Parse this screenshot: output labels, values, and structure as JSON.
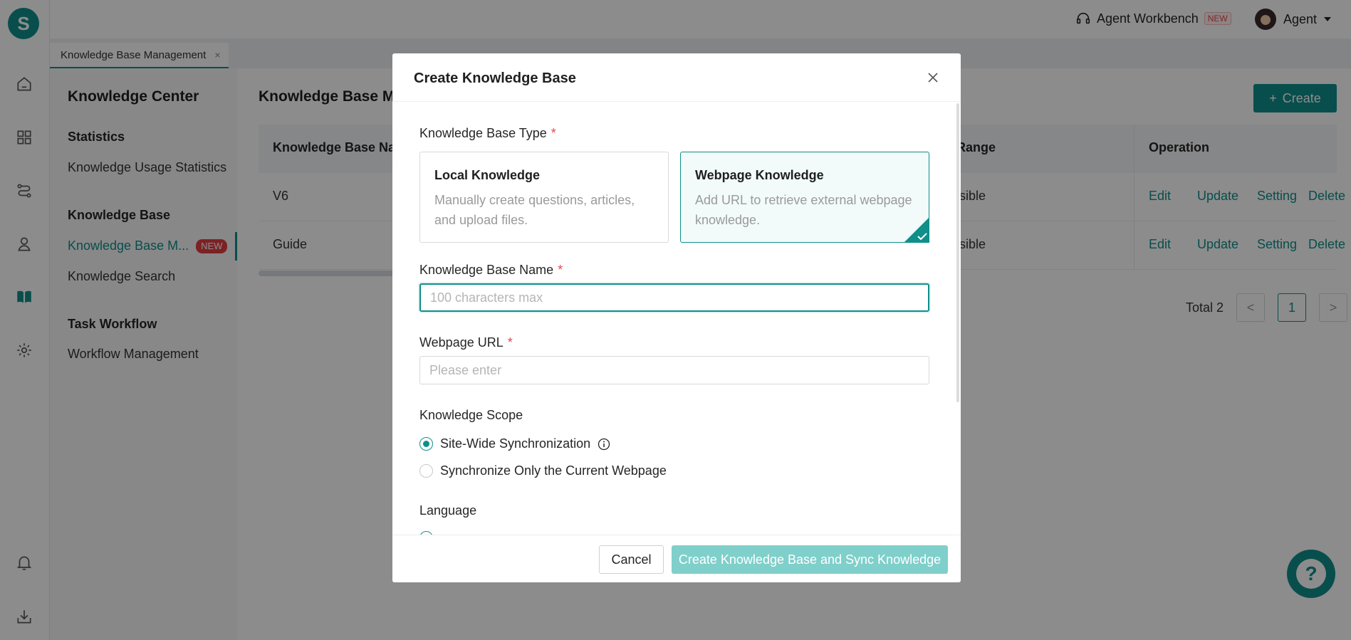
{
  "app": {
    "logo_letter": "S",
    "rail_icons": [
      "home-icon",
      "apps-grid-icon",
      "route-icon",
      "agent-icon",
      "book-icon",
      "gear-icon",
      "bell-icon",
      "download-icon"
    ]
  },
  "topbar": {
    "workbench_label": "Agent Workbench",
    "workbench_badge": "NEW",
    "user_label": "Agent"
  },
  "tabs": [
    {
      "label": "Knowledge Base Management",
      "close": "×"
    }
  ],
  "sidebar": {
    "title": "Knowledge Center",
    "groups": [
      {
        "label": "Statistics",
        "items": [
          {
            "label": "Knowledge Usage Statistics"
          }
        ]
      },
      {
        "label": "Knowledge Base",
        "items": [
          {
            "label": "Knowledge Base M...",
            "badge": "NEW",
            "active": true
          },
          {
            "label": "Knowledge Search"
          }
        ]
      },
      {
        "label": "Task Workflow",
        "items": [
          {
            "label": "Workflow Management"
          }
        ]
      }
    ]
  },
  "main": {
    "title": "Knowledge Base Ma",
    "create_label": "Create",
    "columns": [
      "Knowledge Base Nam",
      "Range",
      "Operation"
    ],
    "rows": [
      {
        "name": "V6",
        "range": "isible",
        "ops": [
          "Edit",
          "Update",
          "Setting",
          "Delete"
        ]
      },
      {
        "name": "Guide",
        "range": "isible",
        "ops": [
          "Edit",
          "Update",
          "Setting",
          "Delete"
        ]
      }
    ],
    "pagination": {
      "total_label": "Total 2",
      "current_page": "1",
      "prev": "<",
      "next": ">"
    }
  },
  "modal": {
    "title": "Create Knowledge Base",
    "type_label": "Knowledge Base Type",
    "required_mark": "*",
    "type_options": [
      {
        "title": "Local Knowledge",
        "desc": "Manually create questions, articles, and upload files.",
        "selected": false
      },
      {
        "title": "Webpage Knowledge",
        "desc": "Add URL to retrieve external webpage knowledge.",
        "selected": true
      }
    ],
    "name_label": "Knowledge Base Name",
    "name_placeholder": "100 characters max",
    "name_value": "",
    "url_label": "Webpage URL",
    "url_placeholder": "Please enter",
    "url_value": "",
    "scope_label": "Knowledge Scope",
    "scope_options": [
      {
        "label": "Site-Wide Synchronization",
        "checked": true,
        "info": true
      },
      {
        "label": "Synchronize Only the Current Webpage",
        "checked": false
      }
    ],
    "language_label": "Language",
    "cancel_label": "Cancel",
    "submit_label": "Create Knowledge Base and Sync Knowledge"
  },
  "colors": {
    "accent": "#0f8f8a",
    "accent_disabled": "#7fcfcb",
    "danger": "#e5484d"
  }
}
